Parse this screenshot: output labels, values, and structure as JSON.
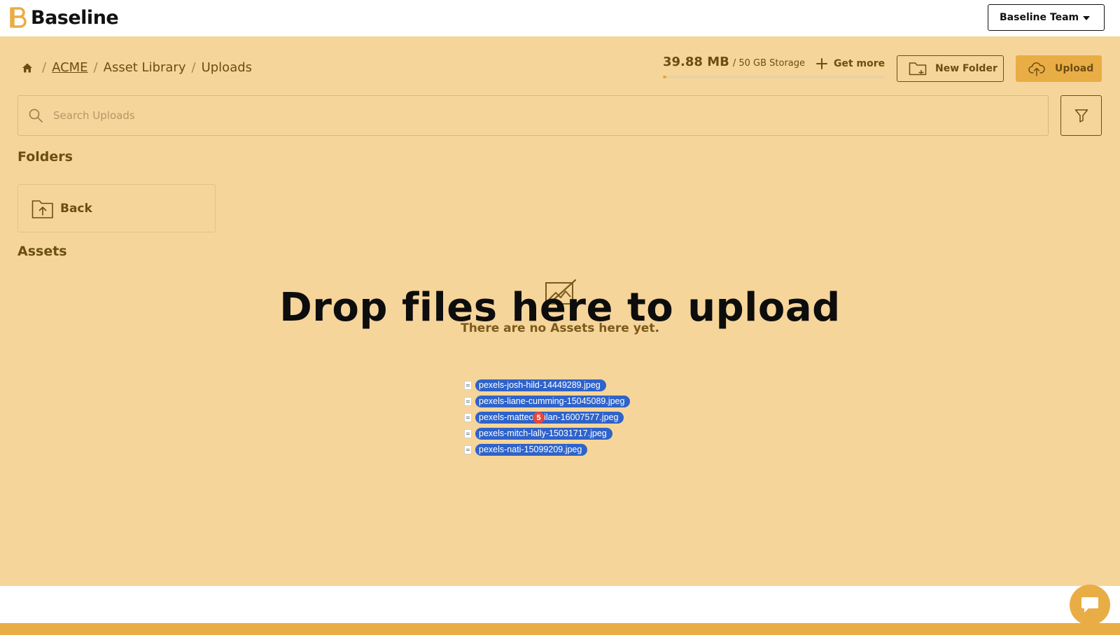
{
  "app": {
    "name": "Baseline"
  },
  "team_select": {
    "label": "Baseline Team"
  },
  "breadcrumb": {
    "items": [
      "ACME",
      "Asset Library",
      "Uploads"
    ],
    "separator": "/"
  },
  "storage": {
    "used": "39.88 MB",
    "total": "/ 50 GB Storage",
    "used_fraction": 0.0008
  },
  "actions": {
    "get_more": "Get more",
    "new_folder": "New Folder",
    "upload": "Upload"
  },
  "search": {
    "placeholder": "Search Uploads",
    "value": ""
  },
  "sections": {
    "folders": "Folders",
    "assets": "Assets"
  },
  "folders": [
    {
      "label": "Back"
    }
  ],
  "empty_state": {
    "message": "There are no Assets here yet."
  },
  "drop_overlay": {
    "message": "Drop files here to upload"
  },
  "dragged_files": {
    "count": "5",
    "names": [
      "pexels-josh-hild-14449289.jpeg",
      "pexels-liane-cumming-15045089.jpeg",
      "pexels-matteo-milan-16007577.jpeg",
      "pexels-mitch-lally-15031717.jpeg",
      "pexels-nati-15099209.jpeg"
    ]
  },
  "colors": {
    "overlay": "#f6d59a",
    "accent": "#e9ad45",
    "text": "#6b4e12",
    "drag_pill": "#2f63c9"
  }
}
